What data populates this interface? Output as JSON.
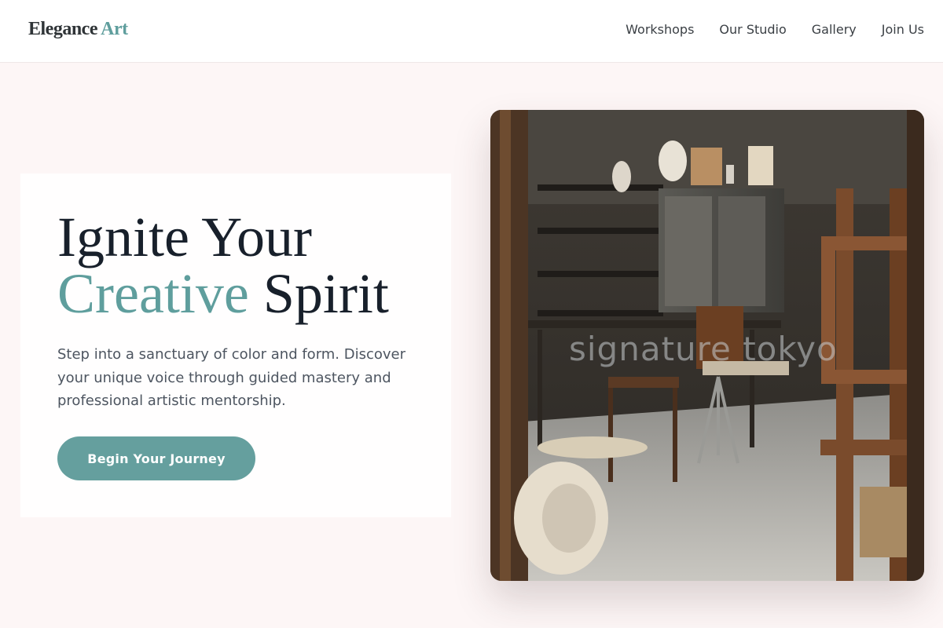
{
  "header": {
    "logo_main": "Elegance",
    "logo_accent": "Art",
    "nav": [
      "Workshops",
      "Our Studio",
      "Gallery",
      "Join Us"
    ]
  },
  "hero": {
    "title_line1": "Ignite Your",
    "title_accent": "Creative",
    "title_rest": "Spirit",
    "description": "Step into a sanctuary of color and form. Discover your unique voice through guided mastery and professional artistic mentorship.",
    "cta_label": "Begin Your Journey"
  },
  "image": {
    "watermark": "signature tokyo",
    "alt": "Art studio interior with easels, chairs and kilns"
  },
  "colors": {
    "accent": "#5f9e9d",
    "button": "#659f9e",
    "background": "#fdf6f6",
    "heading": "#18202b"
  }
}
